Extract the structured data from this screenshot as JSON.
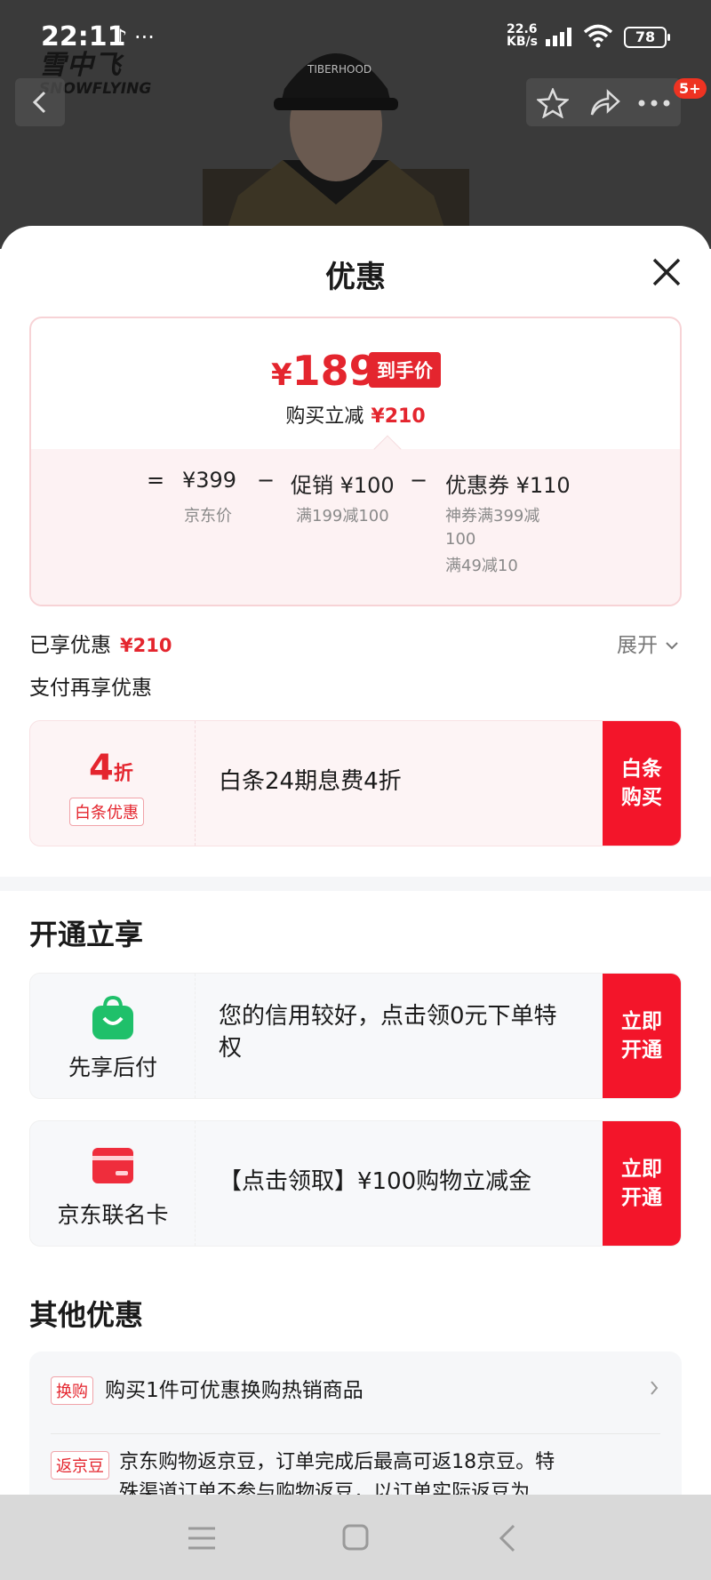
{
  "status_bar": {
    "time": "22:11",
    "extra_icons": "♪ ···",
    "net_speed": "22.6",
    "net_unit": "KB/s",
    "battery": "78"
  },
  "brand": {
    "line1": "雪中飞",
    "line2": "SNOWFLYING"
  },
  "header": {
    "badge": "5+"
  },
  "sheet": {
    "title": "优惠",
    "price": {
      "currency": "¥",
      "final_price": "189",
      "final_tag": "到手价",
      "reduce_label": "购买立减",
      "reduce_value": "¥210"
    },
    "formula": {
      "eq": "=",
      "jd_price": "¥399",
      "jd_price_label": "京东价",
      "minus1": "−",
      "promo": "促销 ¥100",
      "promo_note": "满199减100",
      "minus2": "−",
      "coupon": "优惠券 ¥110",
      "coupon_note_1": "神券满399减",
      "coupon_note_2": "100",
      "coupon_note_3": "满49减10"
    },
    "enjoyed_label": "已享优惠",
    "enjoyed_value": "¥210",
    "expand_label": "展开",
    "pay_more_label": "支付再享优惠",
    "baitiao": {
      "discount_num": "4",
      "discount_unit": "折",
      "tag": "白条优惠",
      "text": "白条24期息费4折",
      "cta_line1": "白条",
      "cta_line2": "购买"
    },
    "open_section_title": "开通立享",
    "pay_later": {
      "name": "先享后付",
      "text_line1": "您的信用较好，点击领0元下单特",
      "text_line2": "权",
      "cta_line1": "立即",
      "cta_line2": "开通"
    },
    "jd_card": {
      "name": "京东联名卡",
      "text": "【点击领取】¥100购物立减金",
      "cta_line1": "立即",
      "cta_line2": "开通"
    },
    "other_section_title": "其他优惠",
    "other_items": [
      {
        "tag": "换购",
        "text": "购买1件可优惠换购热销商品"
      },
      {
        "tag": "返京豆",
        "text_line1": "京东购物返京豆，订单完成后最高可返18京豆。特",
        "text_line2": "殊渠道订单不参与购物返豆，以订单实际返豆为"
      }
    ]
  },
  "colors": {
    "accent": "#e4252e",
    "cta": "#f3152a",
    "pay_later_green": "#1fc06a"
  }
}
